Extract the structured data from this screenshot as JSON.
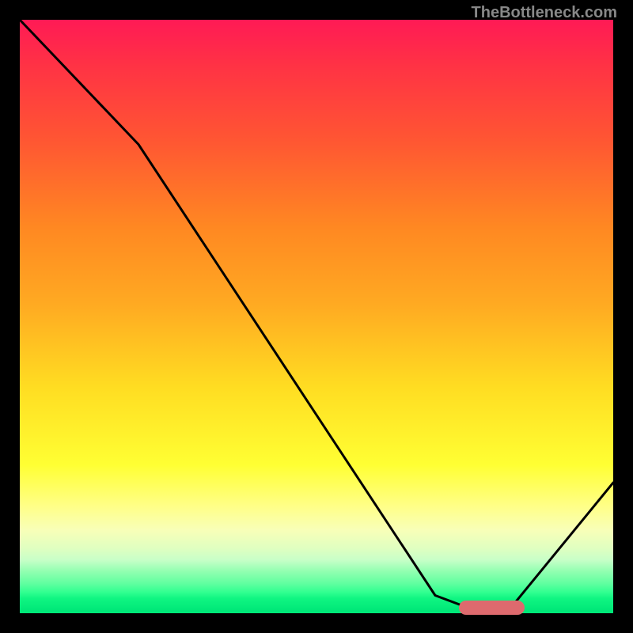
{
  "attribution": "TheBottleneck.com",
  "chart_data": {
    "type": "line",
    "title": "",
    "xlabel": "",
    "ylabel": "",
    "xlim": [
      0,
      100
    ],
    "ylim": [
      0,
      100
    ],
    "series": [
      {
        "name": "bottleneck-curve",
        "x": [
          0,
          20,
          70,
          78,
          82,
          100
        ],
        "values": [
          100,
          79,
          3,
          0,
          0,
          22
        ]
      }
    ],
    "annotations": [
      {
        "name": "optimal-marker",
        "x_range": [
          74,
          85
        ],
        "y": 1
      }
    ],
    "gradient_stops": [
      {
        "pos": 0,
        "color": "#ff1a55"
      },
      {
        "pos": 0.35,
        "color": "#ff8822"
      },
      {
        "pos": 0.62,
        "color": "#ffdd22"
      },
      {
        "pos": 0.82,
        "color": "#ffff88"
      },
      {
        "pos": 1.0,
        "color": "#00e878"
      }
    ]
  }
}
